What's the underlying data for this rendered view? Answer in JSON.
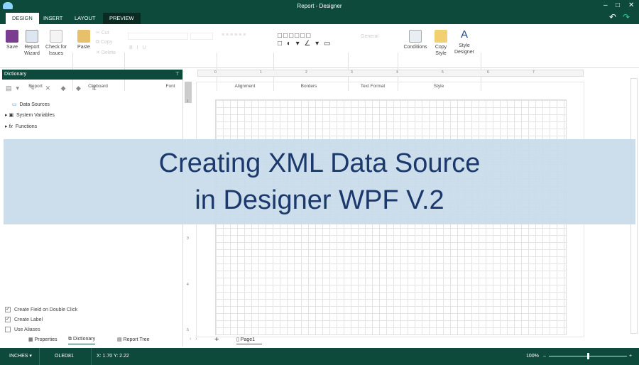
{
  "window": {
    "title": "Report - Designer",
    "minimize": "–",
    "maximize": "□",
    "close": "✕",
    "undo": "↶",
    "redo": "↷"
  },
  "tabs": [
    "DESIGN",
    "INSERT",
    "LAYOUT",
    "PREVIEW"
  ],
  "ribbon": {
    "report": {
      "save": "Save",
      "wizard1": "Report",
      "wizard2": "Wizard",
      "check1": "Check for",
      "check2": "Issues",
      "group": "Report"
    },
    "clipboard": {
      "paste": "Paste",
      "cut": "Cut",
      "copy": "Copy",
      "delete": "Delete",
      "group": "Clipboard"
    },
    "font": {
      "group": "Font",
      "bold": "B",
      "italic": "I",
      "underline": "U"
    },
    "alignment": {
      "group": "Alignment"
    },
    "borders": {
      "group": "Borders"
    },
    "text_format": {
      "general": "General",
      "group": "Text Format"
    },
    "style": {
      "conditions": "Conditions",
      "copy1": "Copy",
      "copy2": "Style",
      "designer1": "Style",
      "designer2": "Designer",
      "group": "Style"
    }
  },
  "dictionary": {
    "title": "Dictionary",
    "items": [
      "Data Sources",
      "System Variables",
      "Functions"
    ],
    "options": [
      {
        "label": "Create Field on Double Click",
        "checked": true
      },
      {
        "label": "Create Label",
        "checked": true
      },
      {
        "label": "Use Aliases",
        "checked": false
      }
    ]
  },
  "ruler": {
    "h": [
      "0",
      "1",
      "2",
      "3",
      "4",
      "5",
      "6",
      "7"
    ],
    "v": [
      "1",
      "3",
      "4",
      "5"
    ]
  },
  "banner": {
    "line1": "Creating XML Data Source",
    "line2": "in Designer WPF V.2"
  },
  "bottom_tabs": [
    "Properties",
    "Dictionary",
    "Report Tree"
  ],
  "page_tab": "Page1",
  "add_page": "+",
  "status": {
    "units": "INCHES ▾",
    "printer": "OLED81",
    "coords": "X: 1.70 Y: 2.22",
    "zoom": "100%",
    "zoom_value": 0.5
  }
}
